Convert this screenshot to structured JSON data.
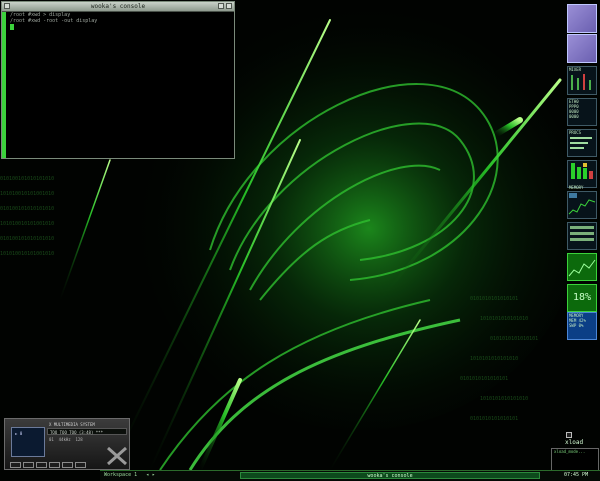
{
  "console": {
    "title": "wooka's console",
    "lines": [
      "/root #xwd > display",
      "/root #xwd -root -out display"
    ]
  },
  "dock": {
    "mixer_label": "MIXER",
    "net_labels": [
      "ETH0",
      "PPP0",
      "0000",
      "0000"
    ],
    "procs_label": "PROCS",
    "mem_label": "MEMORY",
    "cpu_percent": "18%",
    "memory_label": "MEMORY",
    "mem_values": [
      "MEM 42%",
      "SWP 0%"
    ]
  },
  "player": {
    "title": "X MULTIMEDIA SYSTEM",
    "lcd_text": "TOO TOO TOO (3:48) ***",
    "sub": "01  44kHz  128",
    "screen_text": "► 0"
  },
  "taskbar": {
    "workspace": "Workspace 1",
    "active_window": "wooka's console",
    "clock": "07:45 PM"
  },
  "xload": {
    "label": "xload",
    "mini": "xload_mode..."
  },
  "colors": {
    "accent": "#3bd23b",
    "background": "#020402"
  }
}
